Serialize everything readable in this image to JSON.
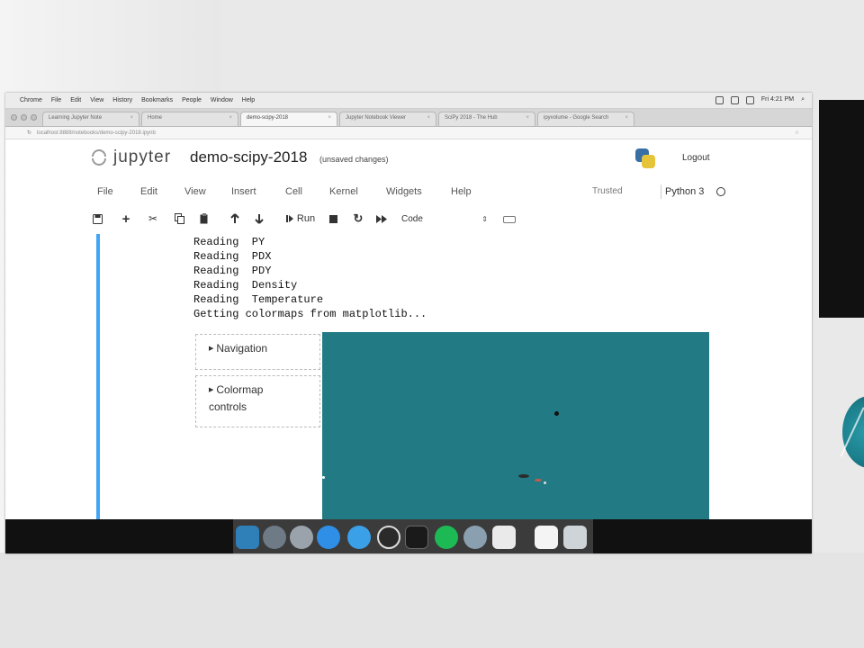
{
  "browser": {
    "menubar": [
      "Chrome",
      "File",
      "Edit",
      "View",
      "History",
      "Bookmarks",
      "People",
      "Window",
      "Help"
    ],
    "clock": "Fri 4:21 PM",
    "tabs": [
      {
        "label": "Learning Jupyter Note",
        "active": false
      },
      {
        "label": "Home",
        "active": false
      },
      {
        "label": "demo-scipy-2018",
        "active": true
      },
      {
        "label": "Jupyter Notebook Viewer",
        "active": false
      },
      {
        "label": "SciPy 2018 - The Hub",
        "active": false
      },
      {
        "label": "ipyvolume - Google Search",
        "active": false
      }
    ],
    "address": "localhost:8888/notebooks/demo-scipy-2018.ipynb"
  },
  "header": {
    "brand": "jupyter",
    "notebook_name": "demo-scipy-2018",
    "save_status": "(unsaved changes)",
    "logout": "Logout"
  },
  "menu": {
    "items": [
      "File",
      "Edit",
      "View",
      "Insert",
      "Cell",
      "Kernel",
      "Widgets",
      "Help"
    ],
    "trusted": "Trusted",
    "kernel_name": "Python 3"
  },
  "toolbar": {
    "run_label": "Run",
    "cell_type": "Code"
  },
  "output": {
    "lines": [
      "Reading  PY",
      "Reading  PDX",
      "Reading  PDY",
      "Reading  Density",
      "Reading  Temperature",
      "Getting colormaps from matplotlib..."
    ]
  },
  "widgets": {
    "navigation": "Navigation",
    "colormap_line1": "Colormap",
    "colormap_line2": "controls"
  },
  "colors": {
    "plot_background": "#227b84",
    "cell_marker": "#42a5f5"
  },
  "icons": {
    "save": "save-icon",
    "add": "plus-icon",
    "cut": "scissors-icon",
    "copy": "copy-icon",
    "paste": "paste-icon",
    "move_up": "arrow-up-icon",
    "move_down": "arrow-down-icon",
    "run": "run-icon",
    "stop": "stop-icon",
    "restart": "restart-icon",
    "fast_forward": "fast-forward-icon",
    "keyboard": "keyboard-icon"
  }
}
